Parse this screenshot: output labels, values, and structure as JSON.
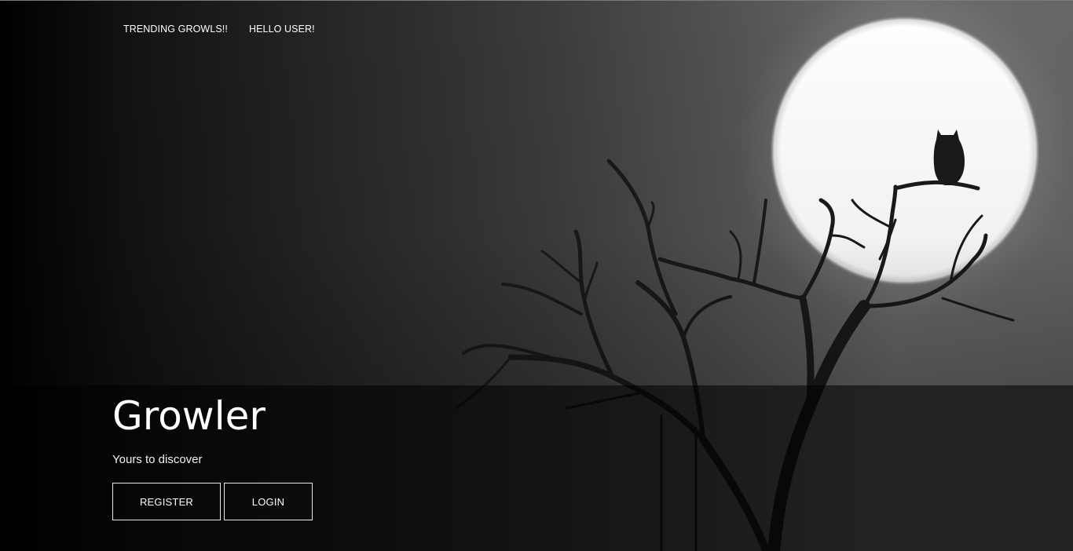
{
  "nav": {
    "items": [
      {
        "label": "TRENDING GROWLS!!"
      },
      {
        "label": "HELLO USER!"
      }
    ]
  },
  "hero": {
    "title": "Growler",
    "subtitle": "Yours to discover",
    "register_label": "REGISTER",
    "login_label": "LOGIN"
  },
  "background": {
    "illustration": "moon-owl-tree-icon",
    "colors": {
      "moon": "#ffffff",
      "silhouette": "#1a1a1a",
      "band": "#0e0e0e"
    }
  }
}
